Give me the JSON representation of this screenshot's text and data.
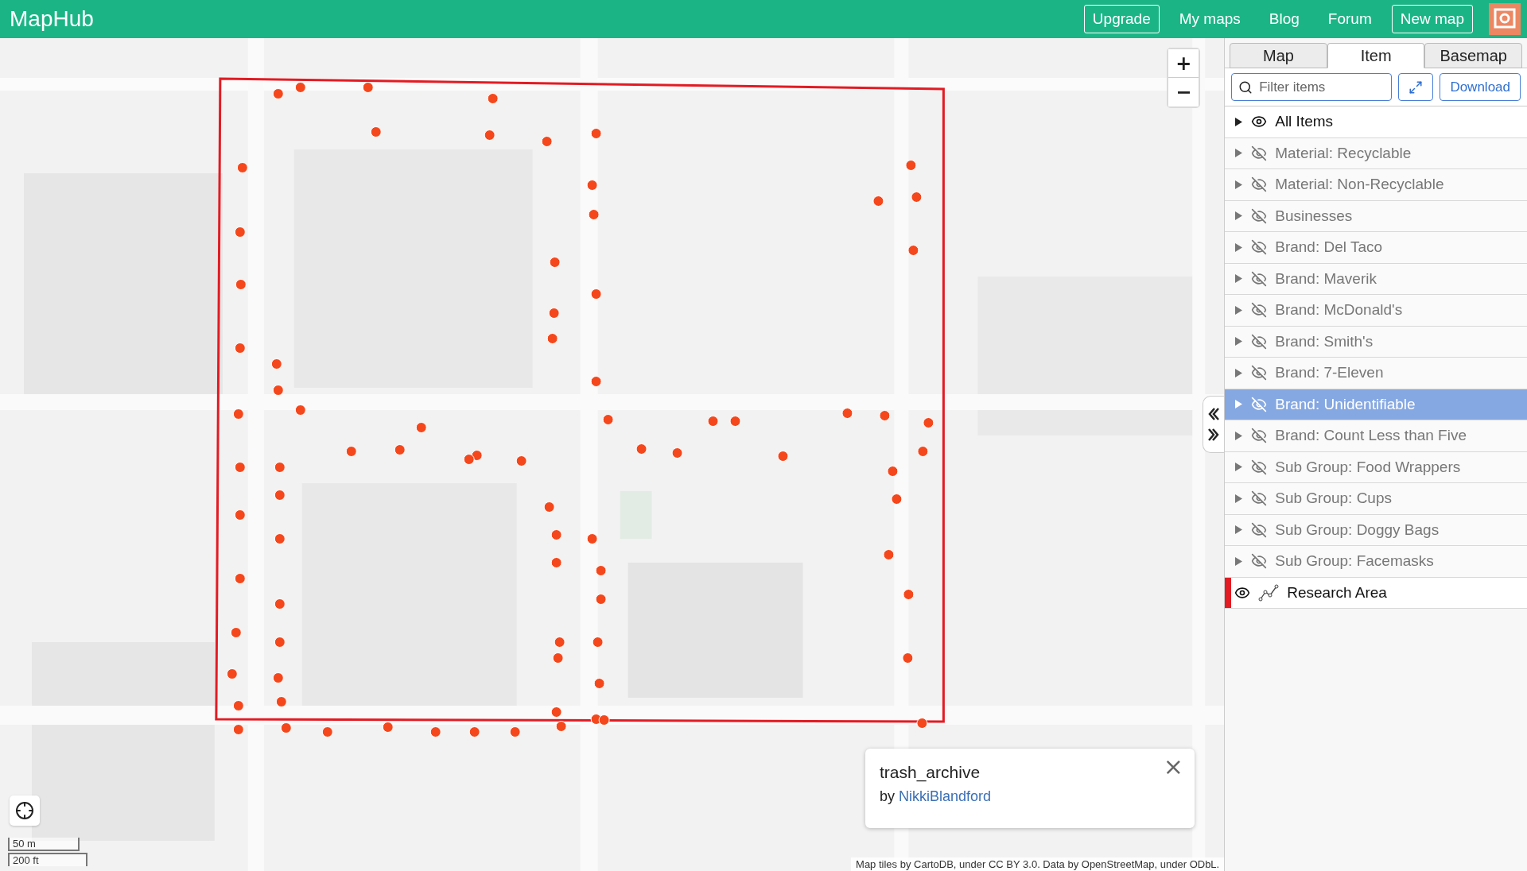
{
  "header": {
    "logo": "MapHub",
    "nav": [
      {
        "label": "Upgrade",
        "kind": "outlined"
      },
      {
        "label": "My maps",
        "kind": "link"
      },
      {
        "label": "Blog",
        "kind": "link"
      },
      {
        "label": "Forum",
        "kind": "link"
      },
      {
        "label": "New map",
        "kind": "outlined"
      }
    ]
  },
  "map": {
    "zoom": {
      "in": "+",
      "out": "−"
    },
    "popup": {
      "title": "trash_archive",
      "by": "by",
      "author": "NikkiBlandford",
      "close": "×"
    },
    "scale": {
      "metric": "50 m",
      "imperial": "200 ft"
    },
    "attribution": "Map tiles by CartoDB, under CC BY 3.0. Data by OpenStreetMap, under ODbL."
  },
  "sidebar": {
    "tabs": [
      {
        "label": "Map",
        "selected": false
      },
      {
        "label": "Item",
        "selected": true
      },
      {
        "label": "Basemap",
        "selected": false
      }
    ],
    "filter": {
      "placeholder": "Filter items"
    },
    "download": "Download",
    "layers": [
      {
        "label": "All Items",
        "kind": "group",
        "visible": true,
        "selected": false
      },
      {
        "label": "Material: Recyclable",
        "kind": "group",
        "visible": false,
        "selected": false
      },
      {
        "label": "Material: Non-Recyclable",
        "kind": "group",
        "visible": false,
        "selected": false
      },
      {
        "label": "Businesses",
        "kind": "group",
        "visible": false,
        "selected": false
      },
      {
        "label": "Brand: Del Taco",
        "kind": "group",
        "visible": false,
        "selected": false
      },
      {
        "label": "Brand: Maverik",
        "kind": "group",
        "visible": false,
        "selected": false
      },
      {
        "label": "Brand: McDonald's",
        "kind": "group",
        "visible": false,
        "selected": false
      },
      {
        "label": "Brand: Smith's",
        "kind": "group",
        "visible": false,
        "selected": false
      },
      {
        "label": "Brand: 7-Eleven",
        "kind": "group",
        "visible": false,
        "selected": false
      },
      {
        "label": "Brand: Unidentifiable",
        "kind": "group",
        "visible": false,
        "selected": true
      },
      {
        "label": "Brand: Count Less than Five",
        "kind": "group",
        "visible": false,
        "selected": false
      },
      {
        "label": "Sub Group: Food Wrappers",
        "kind": "group",
        "visible": false,
        "selected": false
      },
      {
        "label": "Sub Group: Cups",
        "kind": "group",
        "visible": false,
        "selected": false
      },
      {
        "label": "Sub Group: Doggy Bags",
        "kind": "group",
        "visible": false,
        "selected": false
      },
      {
        "label": "Sub Group: Facemasks",
        "kind": "group",
        "visible": false,
        "selected": false
      },
      {
        "label": "Research Area",
        "kind": "line",
        "visible": true,
        "selected": false,
        "color": "#e31b23"
      }
    ]
  }
}
